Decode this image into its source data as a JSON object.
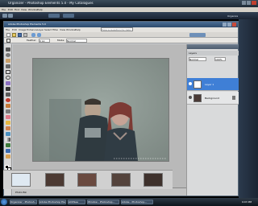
{
  "organizer": {
    "title": "Organizer - Photoshop Elements 5.0 - My Catalogues",
    "menu": [
      "File",
      "Edit",
      "Find",
      "View",
      "Window",
      "Help"
    ],
    "toolbar_right": "Organize"
  },
  "editor": {
    "title": "Adobe Photoshop Elements 5.0",
    "menu": [
      "File",
      "Edit",
      "Image",
      "Enhance",
      "Layer",
      "Select",
      "Filter",
      "View",
      "Window",
      "Help"
    ],
    "search_placeholder": "Type a question for help",
    "options": {
      "feather_label": "Feather:",
      "feather_value": "0 px",
      "mode_label": "Mode:",
      "mode_value": "Normal"
    },
    "layers_panel": {
      "title": "Layers",
      "mode": "Normal",
      "opacity": "100%",
      "layers": [
        {
          "name": "Layer 1"
        },
        {
          "name": "Background"
        }
      ]
    },
    "photo_bin_label": "Photo Bin",
    "bin_thumb_count": 5
  },
  "taskbar": {
    "items": [
      "Organizer - Photosh...",
      "Adobe Photoshop Ele...",
      "ACDSee",
      "Window - Photoshop...",
      "Adobe - Photoshop..."
    ],
    "clock": "9:03 PM"
  }
}
